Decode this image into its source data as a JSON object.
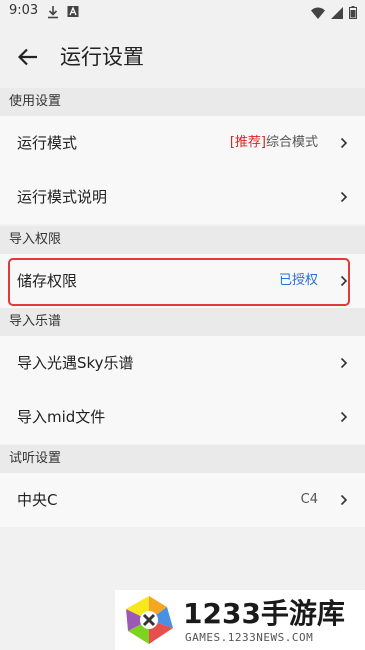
{
  "status_bar": {
    "time": "9:03",
    "left_icons": [
      "download-icon",
      "font-a-icon"
    ],
    "right_icons": [
      "wifi-icon",
      "signal-icon",
      "battery-icon"
    ]
  },
  "app_bar": {
    "title": "运行设置",
    "back_icon": "arrow-left-icon"
  },
  "sections": [
    {
      "header": "使用设置",
      "rows": [
        {
          "label": "运行模式",
          "value_tag": "[推荐]",
          "value": "综合模式"
        },
        {
          "label": "运行模式说明",
          "value": ""
        }
      ]
    },
    {
      "header": "导入权限",
      "rows": [
        {
          "label": "储存权限",
          "value": "已授权",
          "highlighted": true
        }
      ]
    },
    {
      "header": "导入乐谱",
      "rows": [
        {
          "label": "导入光遇Sky乐谱",
          "value": ""
        },
        {
          "label": "导入mid文件",
          "value": ""
        }
      ]
    },
    {
      "header": "试听设置",
      "rows": [
        {
          "label": "中央C",
          "value": "C4"
        }
      ]
    }
  ],
  "watermark": {
    "brand": "1233手游库",
    "url": "GAMES.1233NEWS.COM"
  },
  "colors": {
    "accent_tag": "#dd2222",
    "authorized": "#2a6fd6",
    "highlight_border": "#e03a3a"
  }
}
